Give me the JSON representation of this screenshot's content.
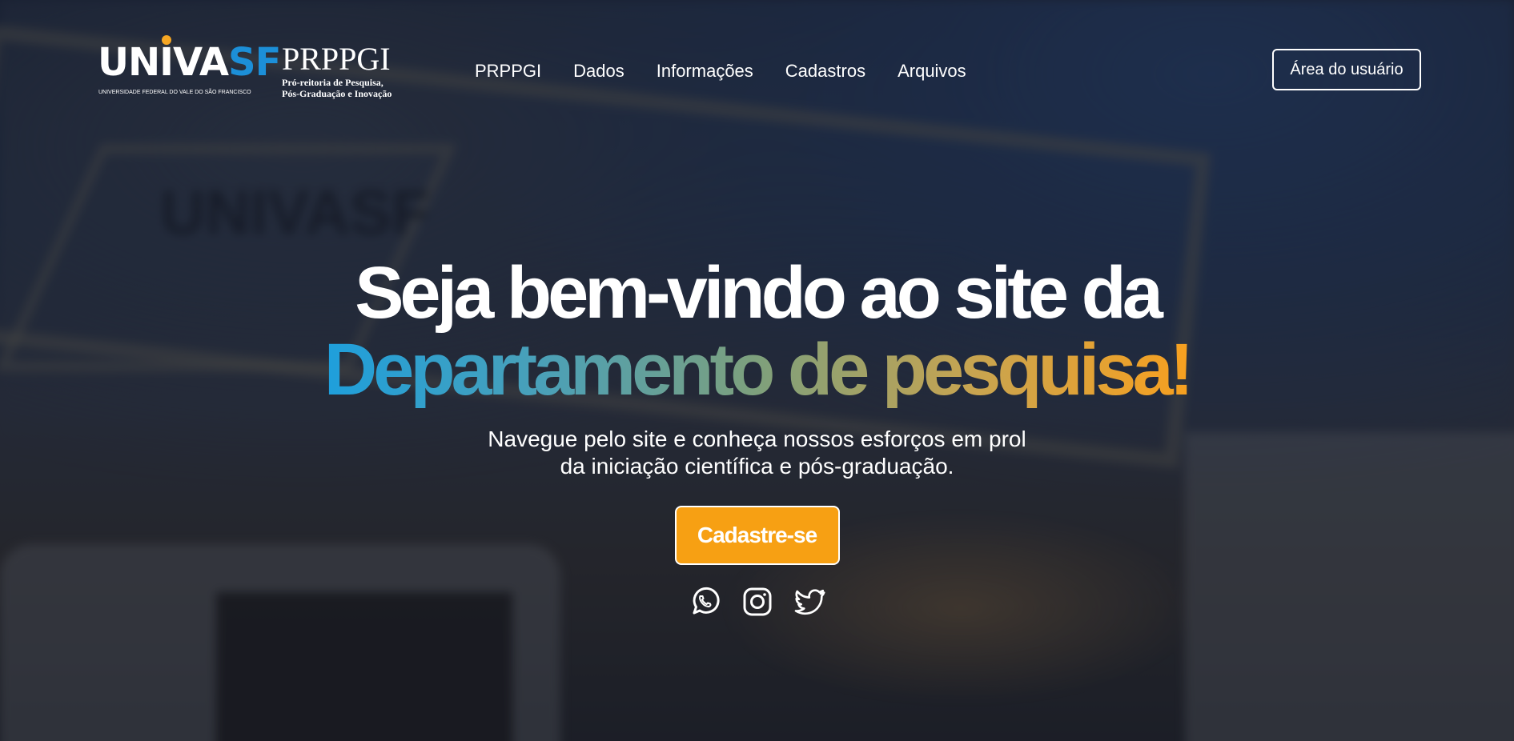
{
  "header": {
    "logo": {
      "univasf_main": "UNIVA",
      "univasf_sf": "SF",
      "univasf_sub": "UNIVERSIDADE FEDERAL DO VALE DO SÃO FRANCISCO",
      "prppgi": "PRPPGI",
      "tagline_1": "Pró-reitoria de Pesquisa,",
      "tagline_2": "Pós-Graduação e Inovação"
    },
    "nav": [
      {
        "label": "PRPPGI"
      },
      {
        "label": "Dados"
      },
      {
        "label": "Informações"
      },
      {
        "label": "Cadastros"
      },
      {
        "label": "Arquivos"
      }
    ],
    "user_area_label": "Área do usuário"
  },
  "hero": {
    "title_line1": "Seja bem-vindo ao site da",
    "title_line2": "Departamento de pesquisa!",
    "subtitle_line1": "Navegue pelo site e conheça nossos esforços em prol",
    "subtitle_line2": "da iniciação científica e pós-graduação.",
    "cta_label": "Cadastre-se",
    "socials": [
      {
        "icon": "whatsapp-icon"
      },
      {
        "icon": "instagram-icon"
      },
      {
        "icon": "twitter-icon"
      }
    ]
  },
  "colors": {
    "accent": "#f7a013",
    "gradient_start": "#1e9fdc",
    "gradient_end": "#f7a01f",
    "brand_blue": "#1c8fd8",
    "brand_dot": "#f5a623"
  }
}
